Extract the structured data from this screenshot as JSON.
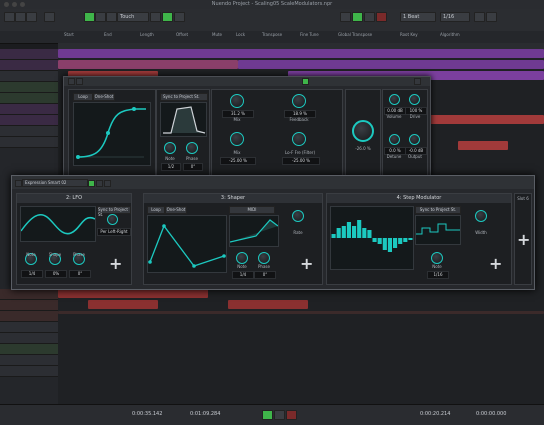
{
  "window": {
    "title": "Nuendo Project - Scaling05 ScaleModulators.npr"
  },
  "toolbar": {
    "tempo_mode": "Touch",
    "snap_value": "1 Beat",
    "quantize": "1/16"
  },
  "infoline": [
    "Start",
    "End",
    "Length",
    "Offset",
    "Mute",
    "Lock",
    "Transpose",
    "Fine Tune",
    "Global Transpose",
    "Root Key",
    "Algorithm"
  ],
  "plugin": {
    "loop_btn": "Loop",
    "oneshot_btn": "One-Shot",
    "sync_label": "Sync to Project St.",
    "knobs_left": [
      {
        "label": "Note",
        "value": "1/2"
      },
      {
        "label": "Phase",
        "value": "0°"
      }
    ],
    "knobs_mid": [
      {
        "label": "Mix",
        "value": "31.2 %"
      },
      {
        "label": "Feedback",
        "value": "18.9 %"
      },
      {
        "label": "Mix",
        "value": "-25.00 %"
      },
      {
        "label": "Lo-F Fre (Filter)",
        "value": "-25.00 %"
      }
    ],
    "center_knob": {
      "value": "-26.0 %"
    },
    "knobs_right": [
      {
        "label": "Volume",
        "value": "0.00 dB"
      },
      {
        "label": "Drive",
        "value": "100 %"
      },
      {
        "label": "Detune",
        "value": "0.0 %"
      },
      {
        "label": "Output",
        "value": "-0.0 dB"
      }
    ]
  },
  "modwin": {
    "preset_name": "Expression Smart 02",
    "slots": [
      {
        "title": "2: LFO",
        "sync": "Sync to Project St.",
        "rate_value": "Per Left-Right",
        "knob_labels": [
          "Note",
          "Shape",
          "Phase"
        ],
        "knob_values": [
          "1/4",
          "0%",
          "0°"
        ]
      },
      {
        "title": "3: Shaper",
        "loop": "Loop",
        "oneshot": "One-Shot",
        "mode": "MIDI",
        "rate": "Rate",
        "knob_labels": [
          "Note",
          "Phase"
        ],
        "knob_values": [
          "1/4",
          "0°"
        ]
      },
      {
        "title": "4: Step Modulator",
        "sync": "Sync to Project St.",
        "width_label": "Width",
        "knob_labels": [
          "Note"
        ],
        "knob_values": [
          "1/16"
        ]
      }
    ],
    "slot_extra": "Slot 6"
  },
  "transport": {
    "pos1": "0:00:35.142",
    "pos2": "0:01:09.284",
    "pos3": "0:00:20.214",
    "pos4": "0:00:00.000"
  },
  "colors": {
    "accent": "#1cc9c0",
    "plugin_bg": "#26282c",
    "clip_purple": "#7b3f9e",
    "clip_red": "#a13a3a",
    "toolbar_green": "#3fb54a"
  },
  "icons": [
    "lock-icon",
    "play-icon",
    "stop-icon",
    "record-icon",
    "plus-icon",
    "loop-icon",
    "settings-icon",
    "power-icon"
  ]
}
